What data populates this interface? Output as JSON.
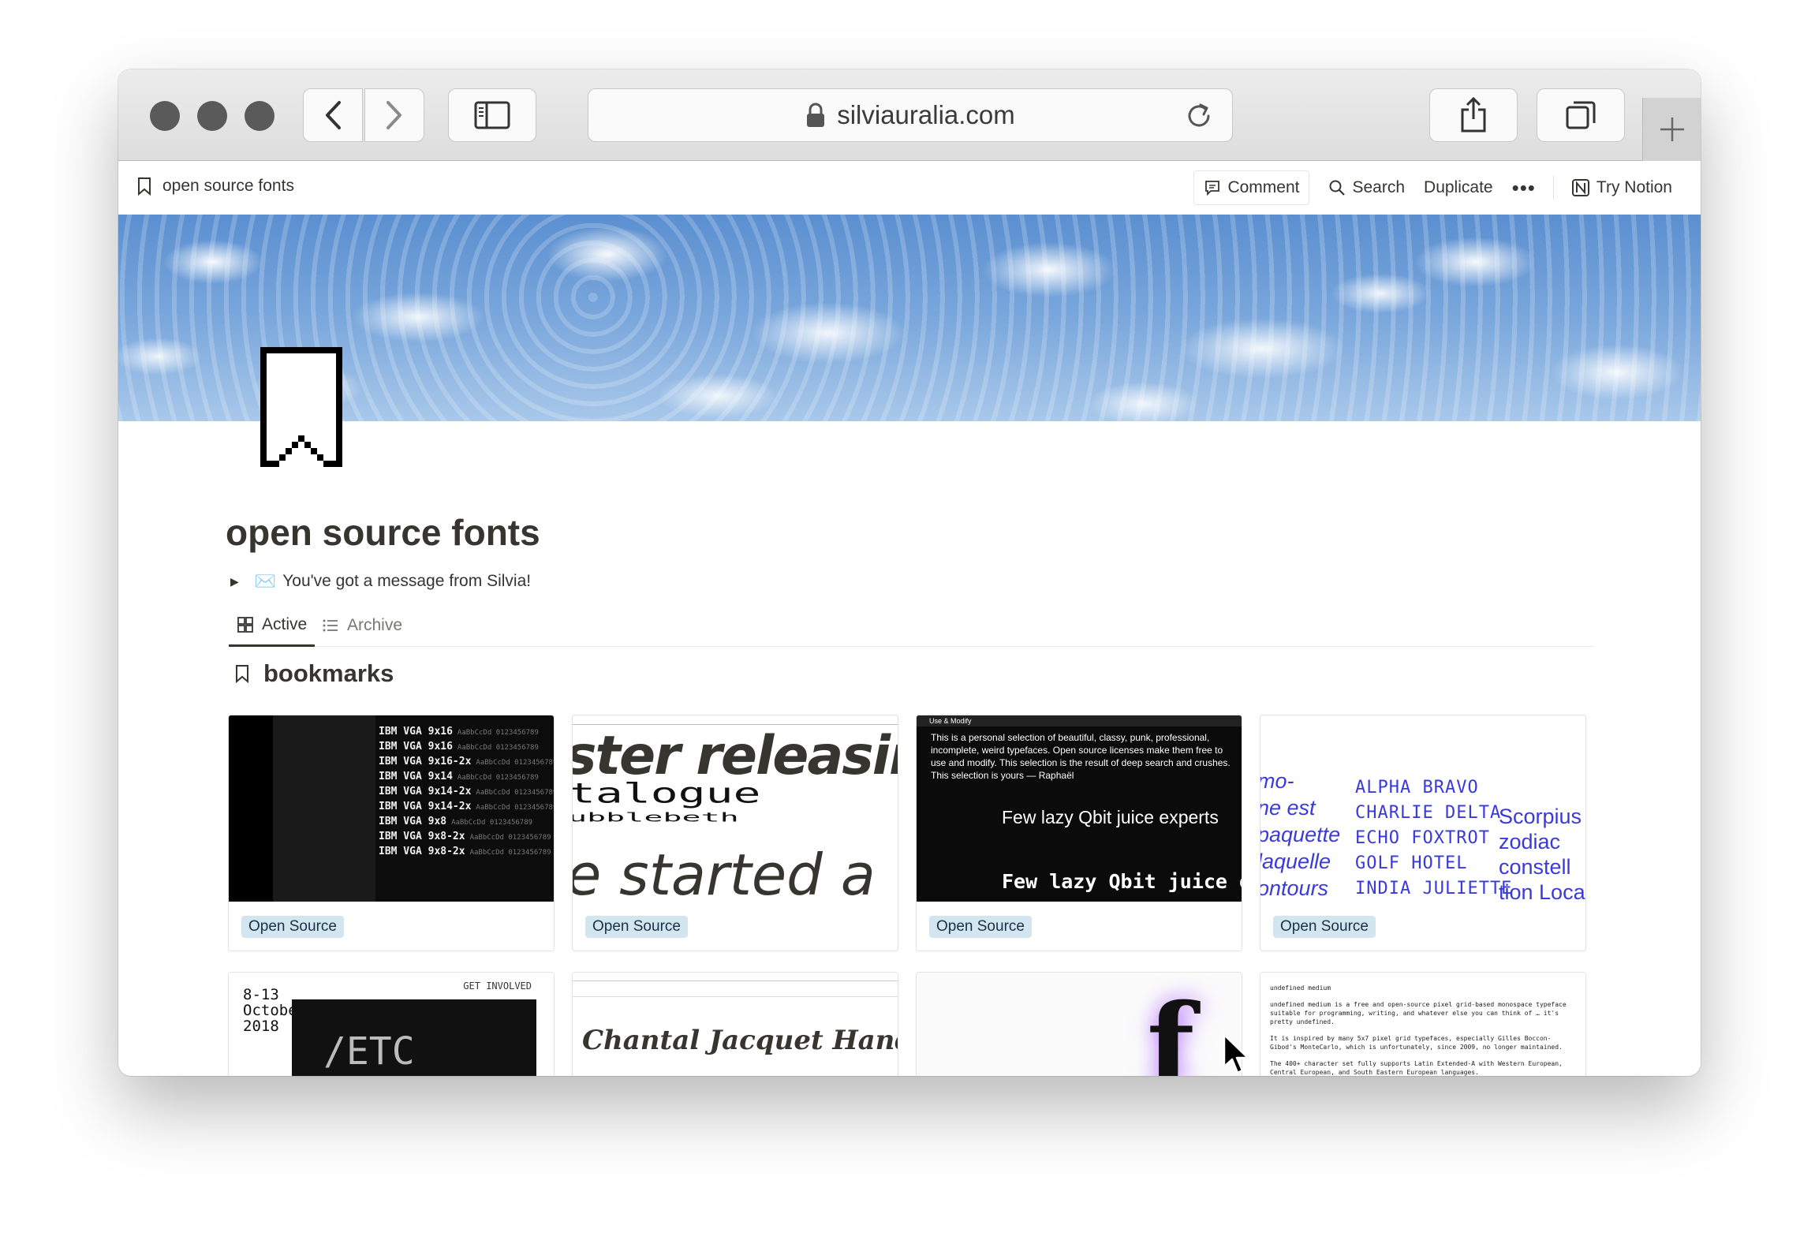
{
  "browser": {
    "url": "silviauralia.com"
  },
  "topbar": {
    "breadcrumb": "open source fonts",
    "comment": "Comment",
    "search": "Search",
    "duplicate": "Duplicate",
    "more": "•••",
    "try_notion": "Try Notion"
  },
  "page": {
    "title": "open source fonts",
    "toggle_emoji": "✉️",
    "toggle_text": "You've got a message from Silvia!",
    "tabs": [
      "Active",
      "Archive"
    ],
    "section_title": "bookmarks"
  },
  "cards": [
    {
      "tag": "Open Source",
      "preview_lines": [
        "IBM VGA 9x16",
        "IBM VGA 9x16",
        "IBM VGA 9x16-2x",
        "IBM VGA 9x14",
        "IBM VGA 9x14-2x",
        "IBM VGA 9x14-2x",
        "IBM VGA 9x8",
        "IBM VGA 9x8-2x",
        "IBM VGA 9x8-2x"
      ],
      "preview_suffix": "AaBbCcDd 0123456789"
    },
    {
      "tag": "Open Source",
      "preview_lines": [
        "ster releasing",
        "talogue",
        "ubblebeth",
        "e started a"
      ]
    },
    {
      "tag": "Open Source",
      "preview_header": "Use & Modify",
      "preview_paragraph": "This is a personal selection of beautiful, classy, punk, professional, incomplete, weird typefaces. Open source licenses make them free to use and modify. This selection is the result of deep search and crushes. This selection is yours — Raphaël",
      "preview_lines": [
        "Few lazy Qbit juice experts",
        "Few lazy Qbit juice expe"
      ]
    },
    {
      "tag": "Open Source",
      "preview_col_a": [
        "mo-",
        "ne est",
        "paquette",
        "laquelle",
        "ontours"
      ],
      "preview_col_b": [
        "ALPHA BRAVO",
        "CHARLIE DELTA",
        "ECHO FOXTROT",
        "GOLF HOTEL",
        "INDIA JULIETTE"
      ],
      "preview_col_c": [
        "Scorpius",
        "zodiac",
        "constell",
        "tion Loca"
      ]
    },
    {
      "preview_date": [
        "8-13",
        "October",
        "2018"
      ],
      "preview_big": "/ETC",
      "preview_corner": "GET INVOLVED"
    },
    {
      "preview_title": "Chantal Jacquet Handwriting"
    },
    {
      "preview_glyph": "f"
    },
    {
      "preview_heading": "undefined medium",
      "preview_paragraphs": [
        "undefined medium is a free and open-source pixel grid-based monospace typeface suitable for programming, writing, and whatever else you can think of … it's pretty undefined.",
        "It is inspired by many 5x7 pixel grid typefaces, especially Gilles Boccon-Gibod's MonteCarlo, which is unfortunately, since 2009, no longer maintained.",
        "The 400+ character set fully supports Latin Extended-A with Western European, Central European, and South Eastern European languages."
      ]
    }
  ]
}
